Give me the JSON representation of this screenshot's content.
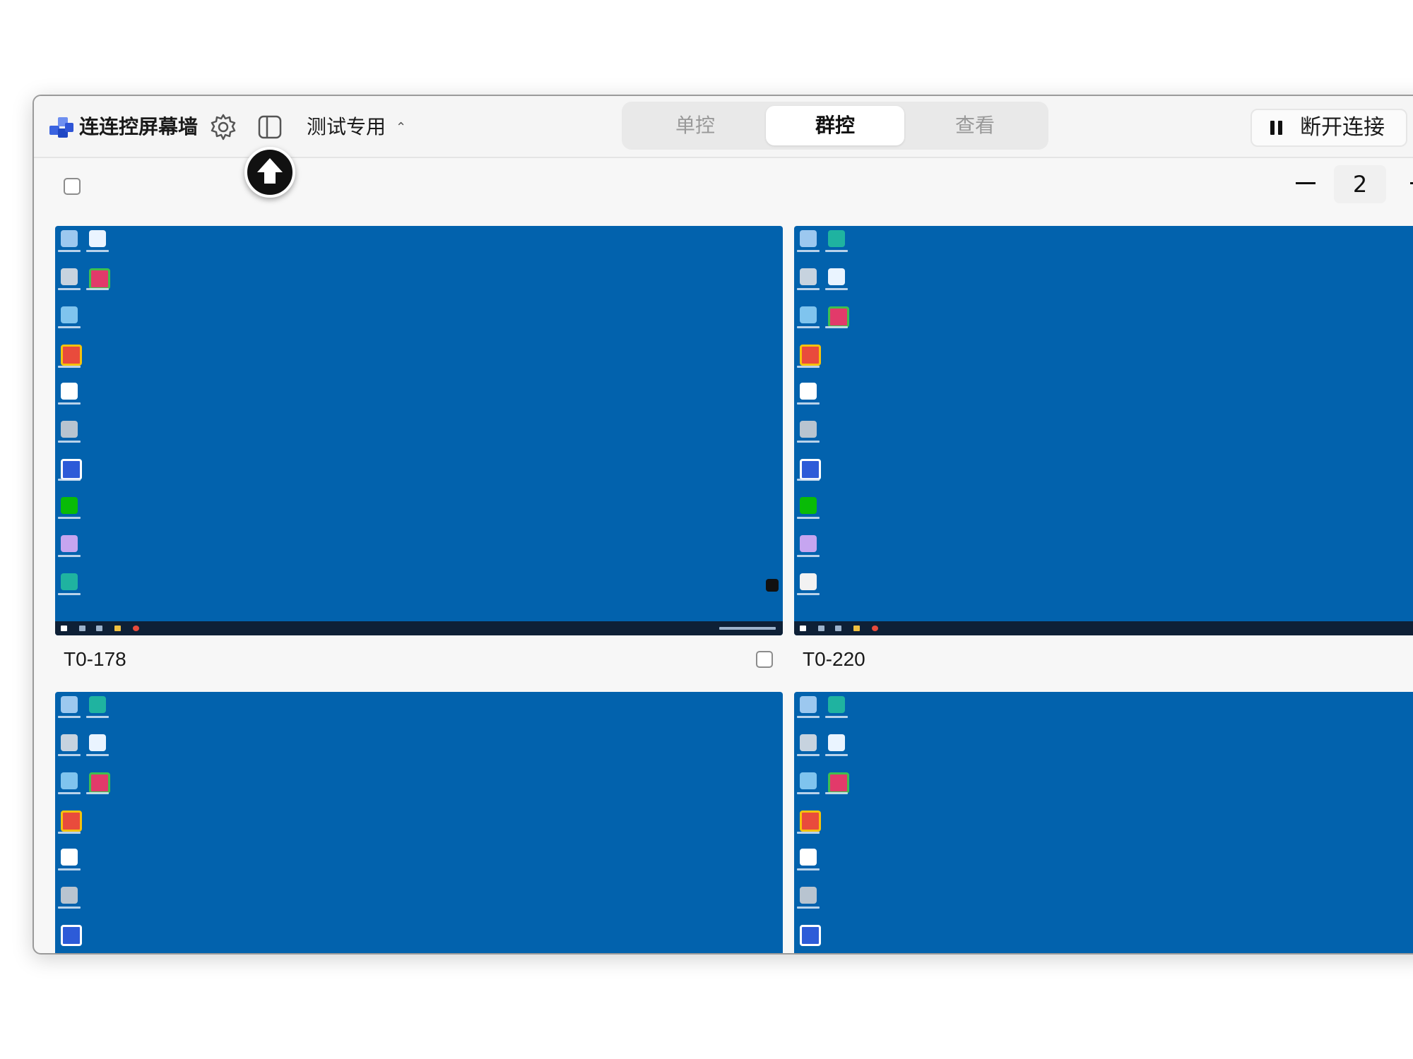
{
  "app": {
    "title": "连连控屏幕墙",
    "workspace": "测试专用"
  },
  "tabs": [
    {
      "label": "单控",
      "active": false
    },
    {
      "label": "群控",
      "active": true
    },
    {
      "label": "查看",
      "active": false
    }
  ],
  "actions": {
    "disconnect_label": "断开连接"
  },
  "columns_stepper": {
    "value": "2"
  },
  "devices": [
    {
      "name": "T0-178"
    },
    {
      "name": "T0-220"
    },
    {
      "name": ""
    },
    {
      "name": ""
    }
  ],
  "colors": {
    "desktop_blue": "#0262ad",
    "taskbar": "#0e2036",
    "brand_blue": "#2d5bd8"
  }
}
